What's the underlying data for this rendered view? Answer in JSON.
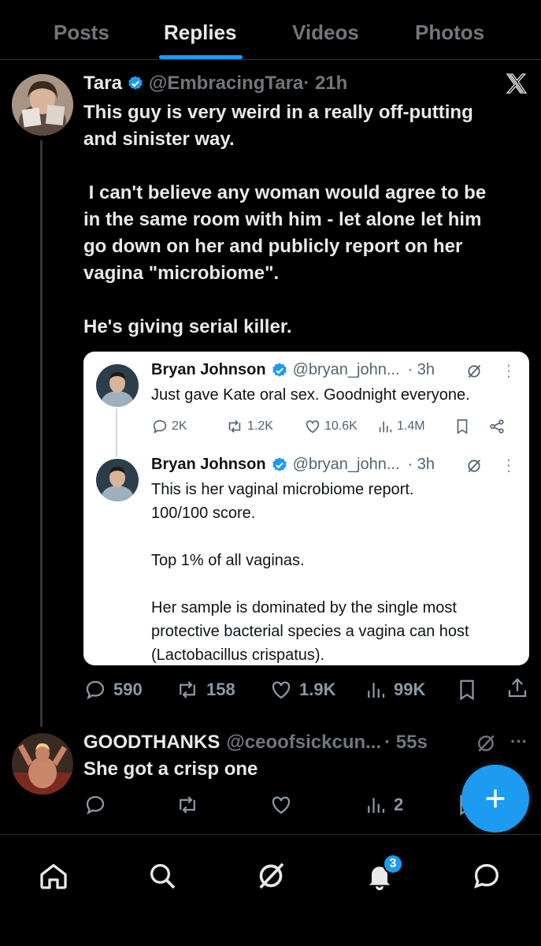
{
  "tabs": [
    {
      "label": "Posts"
    },
    {
      "label": "Replies"
    },
    {
      "label": "Videos"
    },
    {
      "label": "Photos"
    }
  ],
  "main_tweet": {
    "name": "Tara",
    "handle": "@EmbracingTara",
    "time": "· 21h",
    "text": "This guy is very weird in a really off-putting\nand sinister way.\n\n I can't believe any woman would agree to be\nin the same room with him - let alone let him\ngo down on her and publicly report on her\nvagina \"microbiome\".\n\nHe's giving serial killer.",
    "stats": {
      "replies": "590",
      "reposts": "158",
      "likes": "1.9K",
      "views": "99K"
    }
  },
  "quoted": {
    "first": {
      "name": "Bryan Johnson",
      "handle": "@bryan_john...",
      "time": "· 3h",
      "text": "Just gave Kate oral sex. Goodnight everyone.",
      "stats": {
        "replies": "2K",
        "reposts": "1.2K",
        "likes": "10.6K",
        "views": "1.4M"
      }
    },
    "second": {
      "name": "Bryan Johnson",
      "handle": "@bryan_john...",
      "time": "· 3h",
      "text": "This is her vaginal microbiome report.\n100/100 score.\n\nTop 1% of all vaginas.\n\nHer sample is dominated by the single most\nprotective bacterial species a vagina can host\n(Lactobacillus crispatus)."
    }
  },
  "reply": {
    "name": "GOODTHANKS",
    "handle": "@ceoofsickcun...",
    "time": "· 55s",
    "text": "She got a crisp one",
    "stats": {
      "views": "2"
    }
  },
  "notifications_badge": "3",
  "colors": {
    "accent": "#1d9bf0",
    "background": "#000000",
    "muted": "#71767b"
  },
  "icons": [
    "verified-icon",
    "x-logo-icon",
    "reply-icon",
    "repost-icon",
    "like-icon",
    "views-icon",
    "bookmark-icon",
    "share-icon",
    "grok-icon",
    "more-icon",
    "compose-icon",
    "home-icon",
    "search-icon",
    "notifications-icon",
    "messages-icon"
  ]
}
